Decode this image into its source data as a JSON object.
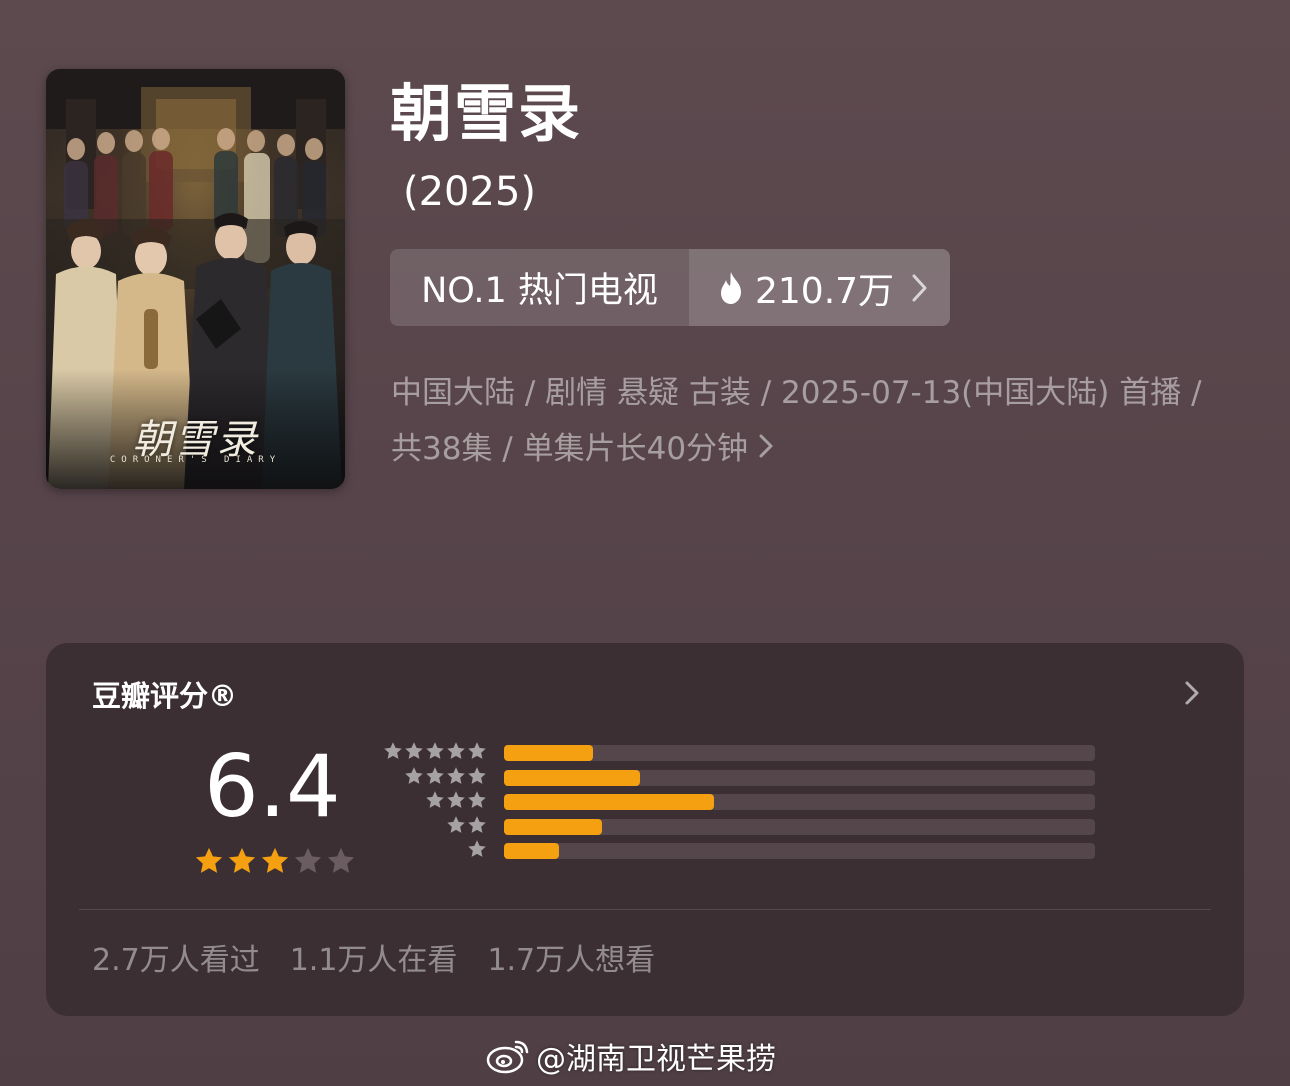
{
  "title": "朝雪录",
  "year": "(2025)",
  "poster": {
    "title_text": "朝雪录",
    "english_text": "CORONER'S DIARY"
  },
  "rank": {
    "label": "NO.1 热门电视",
    "heat": "210.7万",
    "icons": {
      "heat": "flame-icon",
      "chevron": "chevron-right-icon"
    }
  },
  "meta": {
    "line1": "中国大陆 / 剧情 悬疑 古装 / 2025-07-13(中国大陆) 首播 /",
    "line2": "共38集 / 单集片长40分钟"
  },
  "rating_card": {
    "title": "豆瓣评分®",
    "score": "6.4",
    "score_stars": {
      "value": 3,
      "max": 5
    },
    "distribution": [
      {
        "stars": 5,
        "share": 0.15
      },
      {
        "stars": 4,
        "share": 0.23
      },
      {
        "stars": 3,
        "share": 0.355
      },
      {
        "stars": 2,
        "share": 0.165
      },
      {
        "stars": 1,
        "share": 0.093
      }
    ],
    "stats": {
      "watched": "2.7万人看过",
      "watching": "1.1万人在看",
      "wish": "1.7万人想看"
    },
    "colors": {
      "bar_fill": "#f5a011",
      "star_on": "#f5a011",
      "star_off": "#6a5c60"
    }
  },
  "watermark": {
    "text": "@湖南卫视芒果捞",
    "icon": "weibo-icon"
  }
}
